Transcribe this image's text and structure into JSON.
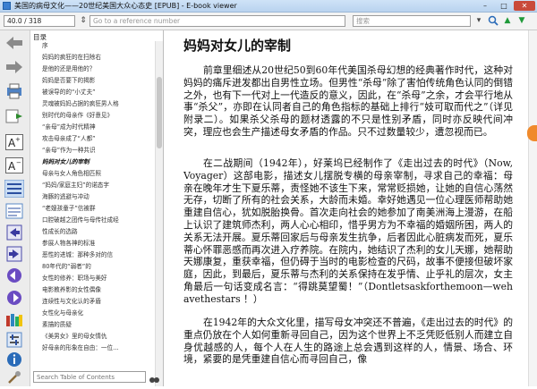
{
  "window": {
    "title": "美国的病母文化——20世纪美国大众心态史 [EPUB] - E-book viewer",
    "minimize": "–",
    "maximize": "□",
    "close": "✕"
  },
  "toolbar": {
    "position": "40.0 / 318",
    "reference_placeholder": "Go to a reference number",
    "search_label": "搜索"
  },
  "toc": {
    "heading": "目录",
    "search_placeholder": "Search Table of Contents",
    "items": [
      {
        "label": "序"
      },
      {
        "label": "妈妈的疯狂的在扫除右"
      },
      {
        "label": "是他的还是用他的？"
      },
      {
        "label": "妈妈是否要下的揭影"
      },
      {
        "label": "被误导的的“小丈夫”"
      },
      {
        "label": "灵魂被妈妈占据的疯狂男人格"
      },
      {
        "label": "别时代的母亲作《好意见》"
      },
      {
        "label": "“亲母”成为时代精神"
      },
      {
        "label": "攻击母亲成了“人都”"
      },
      {
        "label": "“亲母”作为一种共识"
      },
      {
        "label": "妈妈对女儿的宰制"
      },
      {
        "label": "母亲与女人角色相匹照"
      },
      {
        "label": "“妈妈/家庭主妇”的诺态字"
      },
      {
        "label": "海豚的逃避与冲动"
      },
      {
        "label": "“老嫂孩童子”信被群"
      },
      {
        "label": "口腔破越之团传与母传社成经"
      },
      {
        "label": "性成长的选路"
      },
      {
        "label": "参展人物各神的标准"
      },
      {
        "label": "恶性的进城：那种多对的信"
      },
      {
        "label": "80年代的“弱者”的"
      },
      {
        "label": "女性的修养：职场与美好"
      },
      {
        "label": "电影教养影的女性偶像"
      },
      {
        "label": "连续性与文化认的矛盾"
      },
      {
        "label": "女性化与母亲化"
      },
      {
        "label": "素描的质疑"
      },
      {
        "label": "《美男女》里的母女情仇"
      },
      {
        "label": "好母亲的形象在自由：一位…"
      }
    ]
  },
  "content": {
    "title": "妈妈对女儿的宰制",
    "paragraphs": [
      "前章里细述从20世纪50到60年代美国杀母幻想的经典著作时代，这种对妈妈的痛斥迸发都出自男性立场。但男性“杀母”除了害怕传统角色认同的倒错之外，也有下一代对上一代造反的意义，因此，在“杀母”之余，才会平行地从事“杀父”，亦即在认同者自己的角色指标的基础上排行“妓可取而代之”（详见附录二）。如果杀父杀母的题材透露的不只是性别矛盾，同时亦反映代间冲突，理应也会生产描述母女矛盾的作品。只不过数量较少，遭忽视而已。",
      "在二战期间（1942年），好莱坞已经制作了《走出过去的时代》（Now, Voyager）这部电影，描述女儿摆脱专横的母亲宰制，寻求自己的幸福：母亲在晚年才生下夏乐蒂，责怪她不该生下来，常常贬损她，让她的自信心荡然无存，切断了所有的社会关系，大龄而未婚。幸好她遇见一位心理医师帮助她重建自信心，犹如脱胎换骨。首次走向社会的她参加了南美洲海上漫游，在船上认识了建筑师杰利，两人心心相印，惜乎男方为不幸福的婚姻所困，两人的关系无法开展。夏乐蒂回家后与母亲发生抗争，后者因此心脏病发而死，夏乐蒂心怀罪恶感而再次进入疗养院。在院内，她结识了杰利的女儿天娜，她帮助天娜康复，重获幸福，但仍碍于当时的电影检查的尺码，故事不便接但破坏家庭，因此，到最后，夏乐蒂与杰利的关系保持在发乎情、止乎礼的层次，女主角最后一句话变成名言：“得跳莫望蜀！”（Dontletsaskforthemoon—wehavethestars ！）",
      "在1942年的大众文化里，描写母女冲突还不普遍，《走出过去的时代》的重点仍放在个人如何重新寻回自己，因为这个世界上不乏凭贬低别人而建立自身优越感的人，每个人在人生的路途上总会遇到这样的人，情景、场合、环境，紧要的是凭重建自信心而寻回自己，像"
    ]
  }
}
